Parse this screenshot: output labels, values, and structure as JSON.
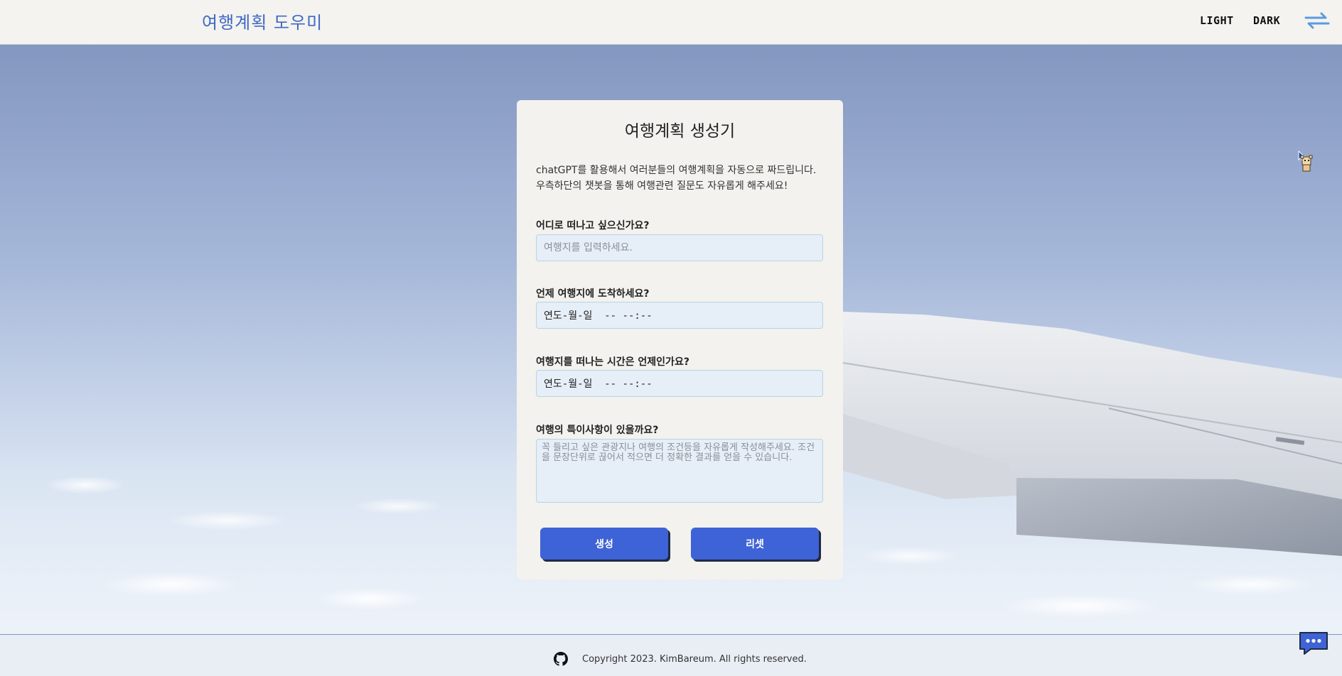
{
  "header": {
    "logo": "여행계획 도우미",
    "light_label": "LIGHT",
    "dark_label": "DARK",
    "menu_icon": "swap-arrows-icon"
  },
  "form": {
    "title": "여행계획 생성기",
    "description": [
      "chatGPT를 활용해서 여러분들의 여행계획을 자동으로 짜드립니다.",
      "우측하단의 챗봇을 통해 여행관련 질문도 자유롭게 해주세요!"
    ],
    "destination": {
      "label": "어디로 떠나고 싶으신가요?",
      "placeholder": "여행지를 입력하세요."
    },
    "arrival": {
      "label": "언제 여행지에 도착하세요?",
      "value": "연도-월-일  -- --:--"
    },
    "departure": {
      "label": "여행지를 떠나는 시간은 언제인가요?",
      "value": "연도-월-일  -- --:--"
    },
    "notes": {
      "label": "여행의 특이사항이 있을까요?",
      "placeholder": "꼭 들리고 싶은 관광지나 여행의 조건등을 자유롭게 작성해주세요. 조건을 문장단위로 끊어서 적으면 더 정확한 결과를 얻을 수 있습니다."
    },
    "generate_label": "생성",
    "reset_label": "리셋"
  },
  "footer": {
    "copyright": "Copyright 2023. KimBareum. All rights reserved.",
    "github_icon": "github-icon",
    "chat_icon": "chat-bubble-icon"
  },
  "colors": {
    "accent": "#3e63d6",
    "logo": "#3f68c4",
    "field_bg": "#e6eef7",
    "card_bg": "#f3f2ee"
  }
}
